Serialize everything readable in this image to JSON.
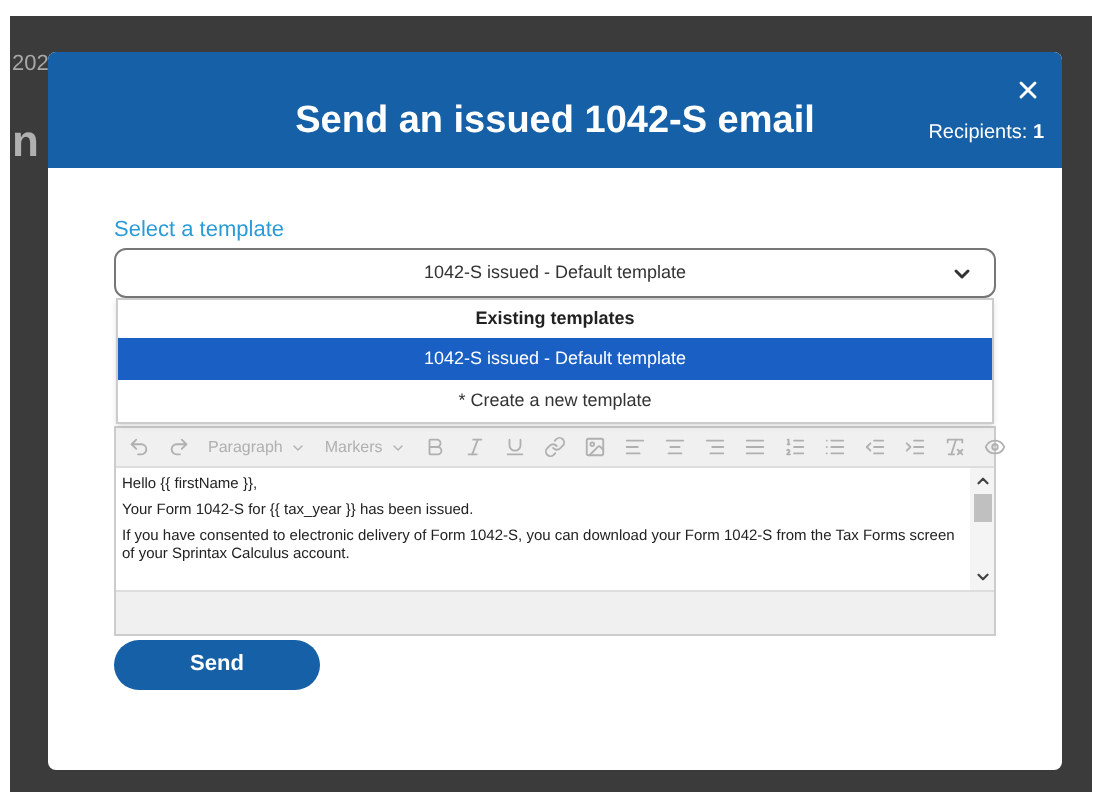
{
  "background": {
    "texts": [
      "202",
      "n"
    ]
  },
  "modal": {
    "title": "Send an issued 1042-S email",
    "recipients_label": "Recipients:",
    "recipients_count": "1"
  },
  "template": {
    "label": "Select a template",
    "value": "1042-S issued - Default template",
    "expanded": true,
    "group_header": "Existing templates",
    "options": [
      {
        "label": "1042-S issued - Default template",
        "selected": true
      },
      {
        "label": "* Create a new template",
        "selected": false
      }
    ]
  },
  "editor": {
    "dropdowns": [
      "Paragraph",
      "Markers"
    ],
    "paragraphs": [
      "Hello {{ firstName }},",
      "Your Form 1042-S for {{ tax_year }} has been issued.",
      "If you have consented to electronic delivery of Form 1042-S, you can download your Form 1042-S from the Tax Forms screen of your Sprintax Calculus account."
    ]
  },
  "send_button": "Send"
}
